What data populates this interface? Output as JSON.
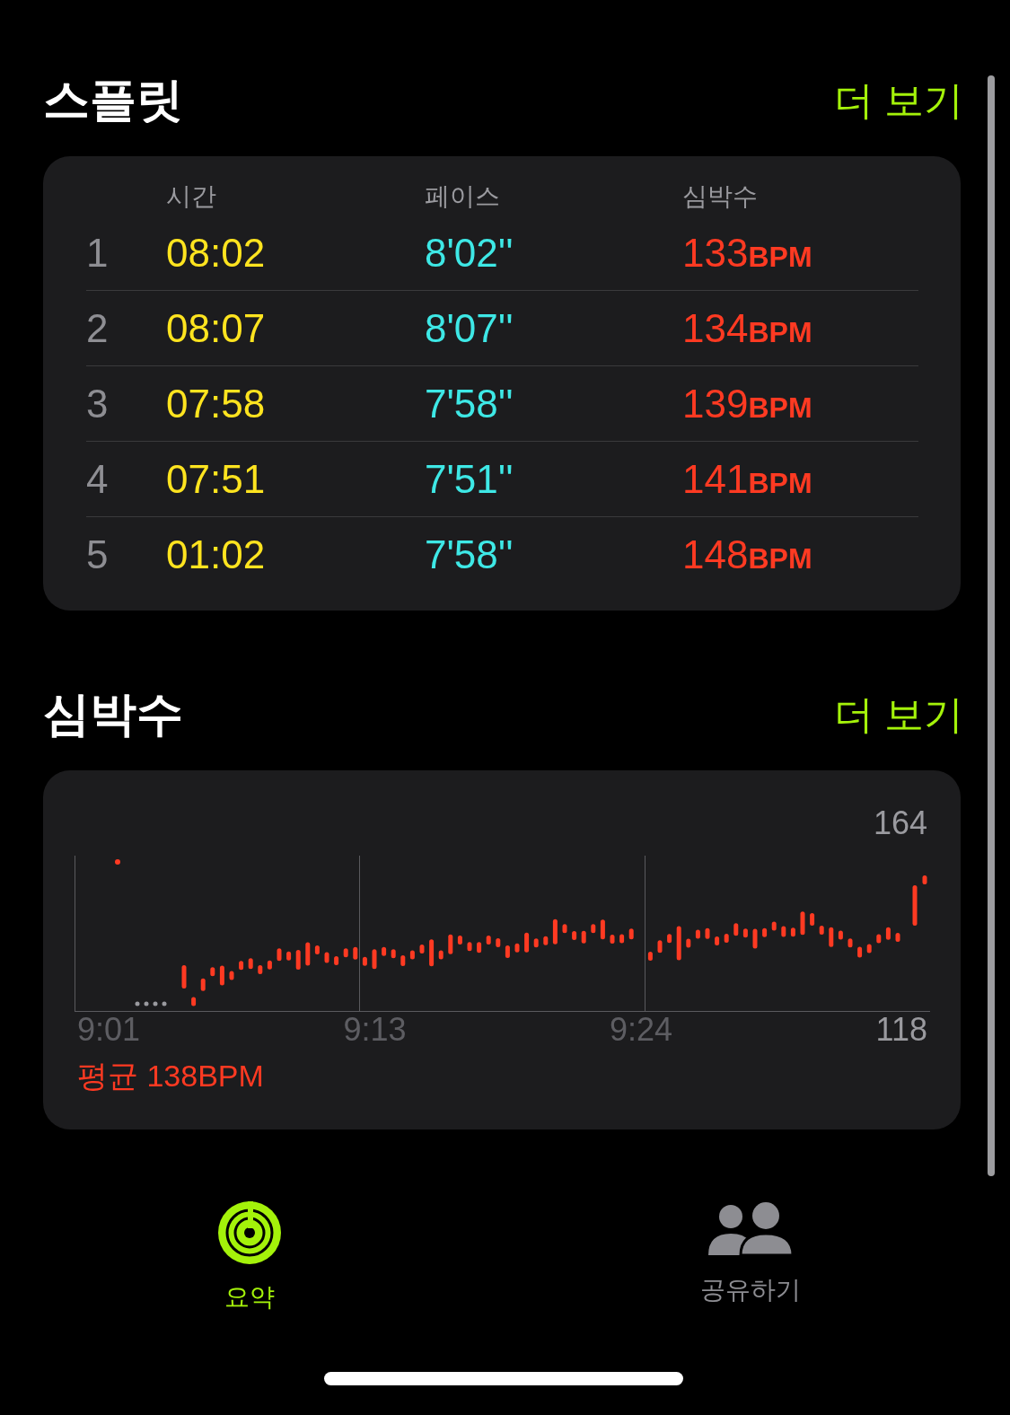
{
  "splits": {
    "title": "스플릿",
    "more": "더 보기",
    "columns": [
      "시간",
      "페이스",
      "심박수"
    ],
    "rows": [
      {
        "index": "1",
        "time": "08:02",
        "pace": "8'02''",
        "heart_rate": "133",
        "unit": "BPM"
      },
      {
        "index": "2",
        "time": "08:07",
        "pace": "8'07''",
        "heart_rate": "134",
        "unit": "BPM"
      },
      {
        "index": "3",
        "time": "07:58",
        "pace": "7'58''",
        "heart_rate": "139",
        "unit": "BPM"
      },
      {
        "index": "4",
        "time": "07:51",
        "pace": "7'51''",
        "heart_rate": "141",
        "unit": "BPM"
      },
      {
        "index": "5",
        "time": "01:02",
        "pace": "7'58''",
        "heart_rate": "148",
        "unit": "BPM"
      }
    ]
  },
  "heart_rate": {
    "title": "심박수",
    "more": "더 보기",
    "max_label": "164",
    "min_label": "118",
    "time_labels": [
      "9:01",
      "9:13",
      "9:24"
    ],
    "average": "평균 138BPM"
  },
  "tabs": [
    {
      "label": "요약",
      "selected": true
    },
    {
      "label": "공유하기",
      "selected": false
    }
  ]
}
